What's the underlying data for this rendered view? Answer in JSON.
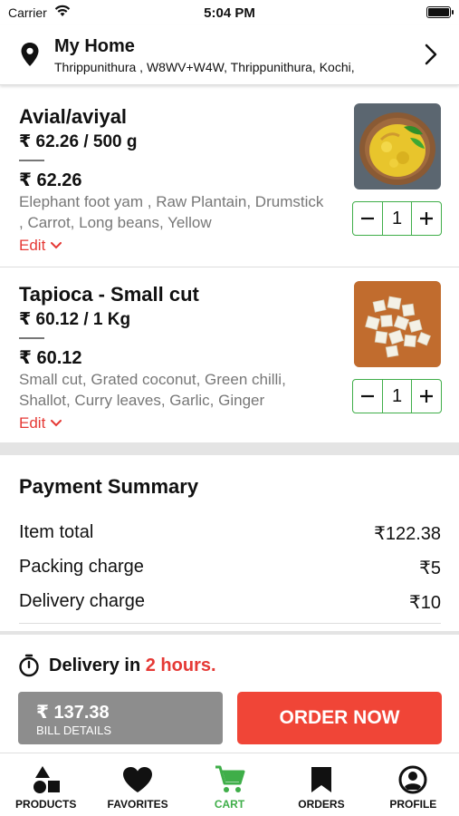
{
  "status": {
    "carrier": "Carrier",
    "time": "5:04 PM"
  },
  "address": {
    "title": "My Home",
    "subtitle": "Thrippunithura , W8WV+W4W, Thrippunithura, Kochi,"
  },
  "items": [
    {
      "name": "Avial/aviyal",
      "unit_price": "₹ 62.26 / 500 g",
      "price": "₹ 62.26",
      "description": "Elephant foot yam , Raw Plantain, Drumstick , Carrot, Long beans, Yellow",
      "edit_label": "Edit",
      "quantity": "1"
    },
    {
      "name": "Tapioca - Small cut",
      "unit_price": "₹ 60.12 / 1 Kg",
      "price": "₹ 60.12",
      "description": "Small cut, Grated coconut, Green chilli, Shallot, Curry leaves, Garlic, Ginger",
      "edit_label": "Edit",
      "quantity": "1"
    }
  ],
  "payment": {
    "heading": "Payment Summary",
    "rows": [
      {
        "label": "Item total",
        "value": "₹122.38"
      },
      {
        "label": "Packing charge",
        "value": "₹5"
      },
      {
        "label": "Delivery charge",
        "value": "₹10"
      }
    ]
  },
  "delivery": {
    "prefix": "Delivery in",
    "highlight": "2 hours."
  },
  "bill": {
    "amount": "₹ 137.38",
    "label": "BILL DETAILS"
  },
  "order_button": "ORDER NOW",
  "tabs": [
    {
      "label": "PRODUCTS",
      "icon": "shapes-icon"
    },
    {
      "label": "FAVORITES",
      "icon": "heart-icon"
    },
    {
      "label": "CART",
      "icon": "cart-icon",
      "active": true
    },
    {
      "label": "ORDERS",
      "icon": "bookmark-icon"
    },
    {
      "label": "PROFILE",
      "icon": "profile-icon"
    }
  ],
  "colors": {
    "accent_green": "#3fae49",
    "accent_red": "#f04537",
    "edit_red": "#e53935",
    "bill_gray": "#8d8d8d"
  }
}
